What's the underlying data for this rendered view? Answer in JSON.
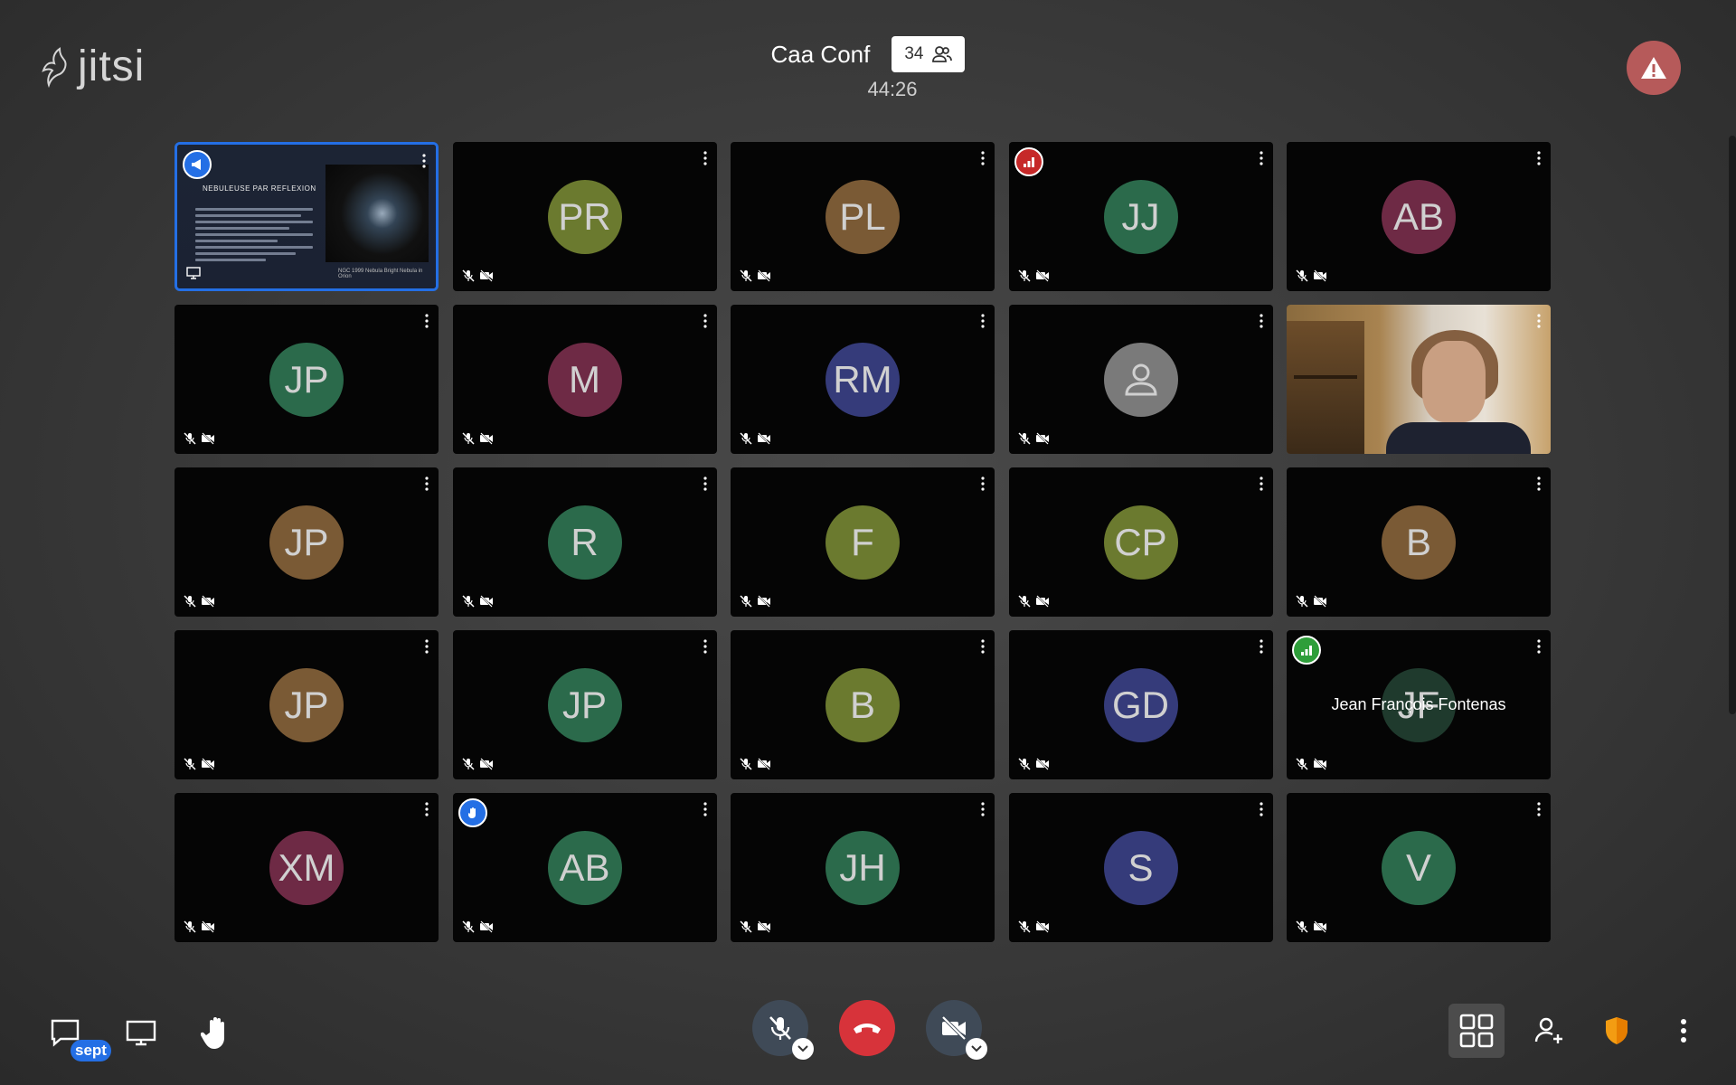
{
  "app": {
    "logo_text": "jitsi"
  },
  "meeting": {
    "title": "Caa Conf",
    "participant_count": "34",
    "timer": "44:26"
  },
  "tiles": [
    {
      "type": "screenshare",
      "slide_heading": "NEBULEUSE PAR REFLEXION",
      "slide_caption": "NGC 1999 Nebula Bright Nebula in Orion",
      "badge": "moderator"
    },
    {
      "initials": "PR",
      "color": "#6b7a2f"
    },
    {
      "initials": "PL",
      "color": "#7a5a35"
    },
    {
      "initials": "JJ",
      "color": "#2b6a4b",
      "badge": "connection-poor"
    },
    {
      "initials": "AB",
      "color": "#6e2a45"
    },
    {
      "initials": "JP",
      "color": "#2b6a4b"
    },
    {
      "initials": "M",
      "color": "#6e2a45"
    },
    {
      "initials": "RM",
      "color": "#353b7a"
    },
    {
      "initials": "",
      "color": "#7a7a7a",
      "type": "default-avatar"
    },
    {
      "type": "camera"
    },
    {
      "initials": "JP",
      "color": "#7a5a35"
    },
    {
      "initials": "R",
      "color": "#2b6a4b"
    },
    {
      "initials": "F",
      "color": "#6b7a2f"
    },
    {
      "initials": "CP",
      "color": "#6b7a2f"
    },
    {
      "initials": "B",
      "color": "#7a5a35"
    },
    {
      "initials": "JP",
      "color": "#7a5a35"
    },
    {
      "initials": "JP",
      "color": "#2b6a4b"
    },
    {
      "initials": "B",
      "color": "#6b7a2f"
    },
    {
      "initials": "GD",
      "color": "#353b7a"
    },
    {
      "initials": "JF",
      "color": "#1f3a2d",
      "badge": "connection-good",
      "hover_name": "Jean François Fontenas"
    },
    {
      "initials": "XM",
      "color": "#6e2a45"
    },
    {
      "initials": "AB",
      "color": "#2b6a4b",
      "badge": "raised-hand"
    },
    {
      "initials": "JH",
      "color": "#2b6a4b"
    },
    {
      "initials": "S",
      "color": "#353b7a"
    },
    {
      "initials": "V",
      "color": "#2b6a4b"
    }
  ],
  "toolbar": {
    "chat_badge": "sept",
    "icons": [
      "chat-icon",
      "screen-share-icon",
      "raise-hand-icon",
      "microphone-muted-icon",
      "hangup-icon",
      "camera-off-icon",
      "tile-view-icon",
      "invite-icon",
      "security-shield-icon",
      "more-options-icon"
    ]
  },
  "colors": {
    "accent": "#246fe5",
    "hangup": "#d7333a",
    "warning": "#b65a5a",
    "shield": "#f39c12"
  }
}
